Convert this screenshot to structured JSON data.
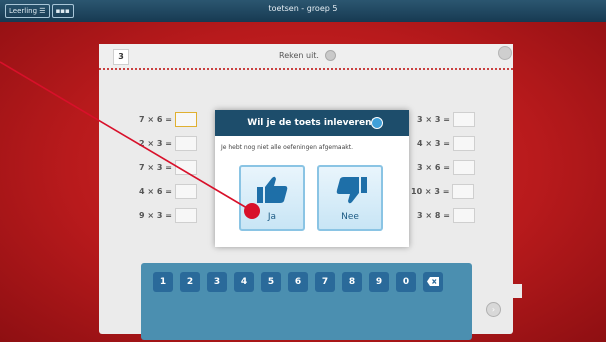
{
  "topbar": {
    "left_button": "Leerling",
    "title": "toetsen - groep 5"
  },
  "sheet": {
    "question_number": "3",
    "instruction": "Reken uit."
  },
  "left_equations": [
    "7 × 6 =",
    "2 × 3 =",
    "7 × 3 =",
    "4 × 6 =",
    "9 × 3 ="
  ],
  "right_equations": [
    "3 × 3 =",
    "4 × 3 =",
    "3 × 6 =",
    "10 × 3 =",
    "3 × 8 ="
  ],
  "keypad": {
    "keys": [
      "1",
      "2",
      "3",
      "4",
      "5",
      "6",
      "7",
      "8",
      "9",
      "0"
    ]
  },
  "modal": {
    "title": "Wil je de toets inleveren?",
    "message": "Je hebt nog niet alle oefeningen afgemaakt.",
    "yes_label": "Ja",
    "no_label": "Nee"
  },
  "icons": {
    "menu": "menu-icon",
    "grid": "grid-icon",
    "speaker": "speaker-icon",
    "thumbs_up": "thumbs-up-icon",
    "thumbs_down": "thumbs-down-icon",
    "backspace": "backspace-icon"
  },
  "colors": {
    "background": "#b3181a",
    "topbar": "#1d4d6b",
    "keypad": "#4b8fb0",
    "key": "#2a6a9a",
    "pointer": "#d8102a"
  }
}
